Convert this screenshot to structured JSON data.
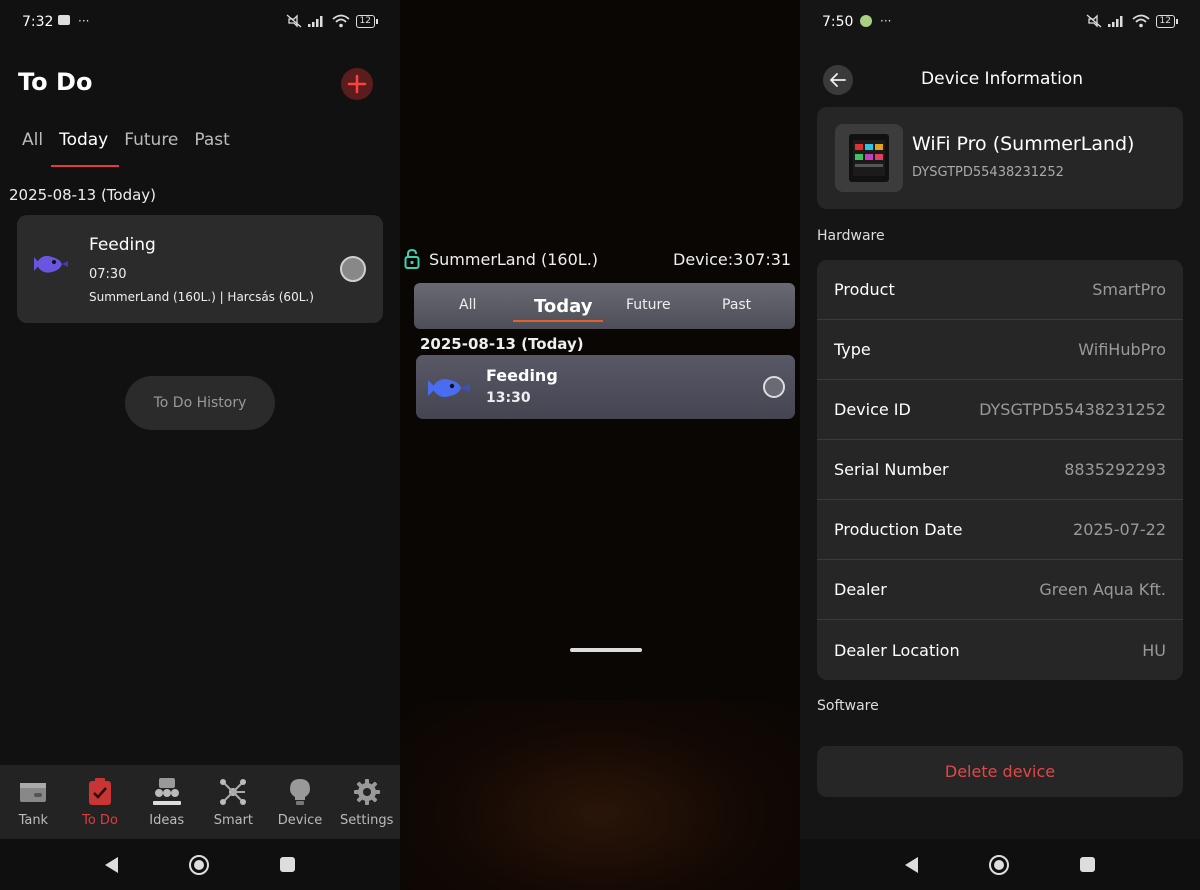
{
  "panel1": {
    "status": {
      "time": "7:32",
      "dots": "···",
      "battery": "12"
    },
    "title": "To Do",
    "tabs": [
      "All",
      "Today",
      "Future",
      "Past"
    ],
    "active_tab": "Today",
    "date_header": "2025-08-13 (Today)",
    "task": {
      "title": "Feeding",
      "time": "07:30",
      "location": "SummerLand (160L.) | Harcsás (60L.)"
    },
    "history_button": "To Do History",
    "nav": [
      {
        "label": "Tank",
        "icon": "tank-icon"
      },
      {
        "label": "To Do",
        "icon": "todo-icon"
      },
      {
        "label": "Ideas",
        "icon": "ideas-icon"
      },
      {
        "label": "Smart",
        "icon": "smart-icon"
      },
      {
        "label": "Device",
        "icon": "lightbulb-icon"
      },
      {
        "label": "Settings",
        "icon": "gear-icon"
      }
    ],
    "active_nav": "To Do",
    "accent": "#e23b3b"
  },
  "panel2": {
    "tank_name": "SummerLand (160L.)",
    "device_count": "Device:3",
    "clock": "07:31",
    "tabs": [
      "All",
      "Today",
      "Future",
      "Past"
    ],
    "active_tab": "Today",
    "date_header": "2025-08-13 (Today)",
    "task": {
      "title": "Feeding",
      "time": "13:30"
    }
  },
  "panel3": {
    "status": {
      "time": "7:50",
      "dots": "···",
      "battery": "12"
    },
    "title": "Device Information",
    "device": {
      "name": "WiFi Pro (SummerLand)",
      "id": "DYSGTPD55438231252"
    },
    "hardware_label": "Hardware",
    "rows": [
      {
        "key": "Product",
        "value": "SmartPro"
      },
      {
        "key": "Type",
        "value": "WifiHubPro"
      },
      {
        "key": "Device ID",
        "value": "DYSGTPD55438231252"
      },
      {
        "key": "Serial Number",
        "value": "8835292293"
      },
      {
        "key": "Production Date",
        "value": "2025-07-22"
      },
      {
        "key": "Dealer",
        "value": "Green Aqua Kft."
      },
      {
        "key": "Dealer Location",
        "value": "HU"
      }
    ],
    "software_label": "Software",
    "delete_button": "Delete device",
    "danger_color": "#e04848"
  }
}
